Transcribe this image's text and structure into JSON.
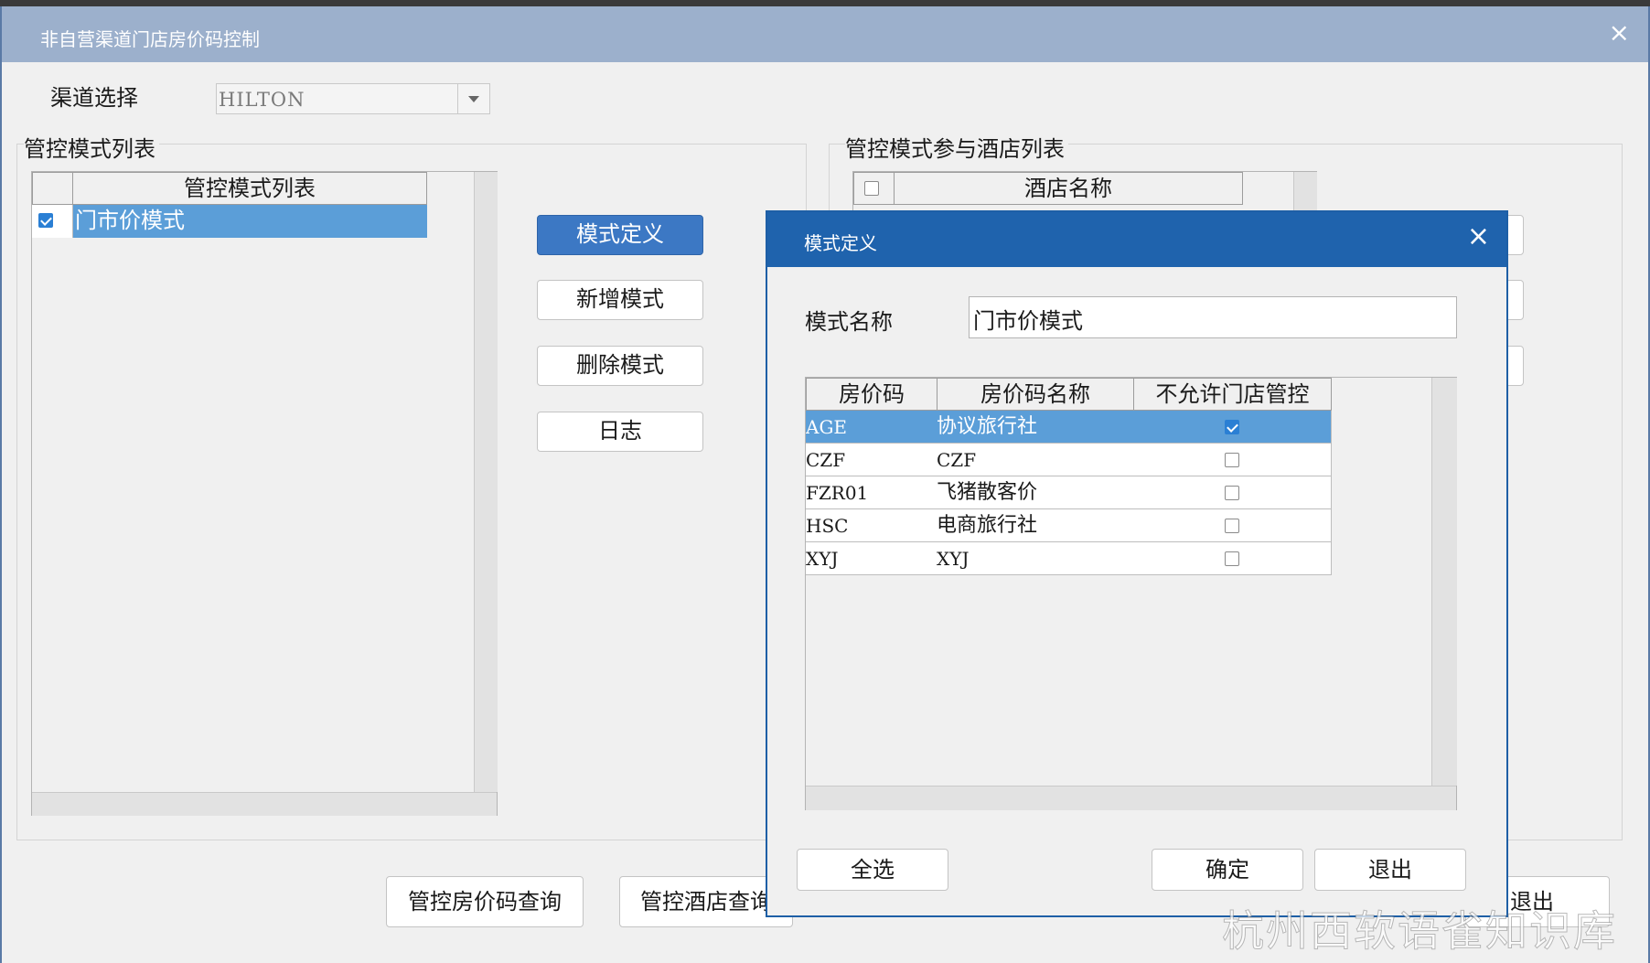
{
  "window": {
    "title": "非自营渠道门店房价码控制",
    "close": "×"
  },
  "channel": {
    "label": "渠道选择",
    "value": "HILTON"
  },
  "left_group": {
    "caption": "管控模式列表",
    "column": "管控模式列表",
    "rows": [
      {
        "checked": true,
        "name": "门市价模式"
      }
    ]
  },
  "middle_buttons": {
    "define": "模式定义",
    "add": "新增模式",
    "delete": "删除模式",
    "log": "日志"
  },
  "right_group": {
    "caption": "管控模式参与酒店列表",
    "column": "酒店名称"
  },
  "bottom_buttons": {
    "rate_query": "管控房价码查询",
    "hotel_query": "管控酒店查询",
    "exit_partial": "退出"
  },
  "dialog": {
    "title": "模式定义",
    "close": "×",
    "name_label": "模式名称",
    "name_value": "门市价模式",
    "columns": [
      "房价码",
      "房价码名称",
      "不允许门店管控"
    ],
    "rows": [
      {
        "code": "AGE",
        "name": "协议旅行社",
        "blocked": true,
        "selected": true
      },
      {
        "code": "CZF",
        "name": "CZF",
        "blocked": false,
        "selected": false
      },
      {
        "code": "FZR01",
        "name": "飞猪散客价",
        "blocked": false,
        "selected": false
      },
      {
        "code": "HSC",
        "name": "电商旅行社",
        "blocked": false,
        "selected": false
      },
      {
        "code": "XYJ",
        "name": "XYJ",
        "blocked": false,
        "selected": false
      }
    ],
    "select_all": "全选",
    "ok": "确定",
    "exit": "退出"
  },
  "watermark": "杭州西软语雀知识库",
  "colors": {
    "title_bar": "#9cb0cc",
    "dialog_title": "#1f63ad",
    "selection": "#5b9ed8",
    "primary_button": "#3c78c4"
  }
}
